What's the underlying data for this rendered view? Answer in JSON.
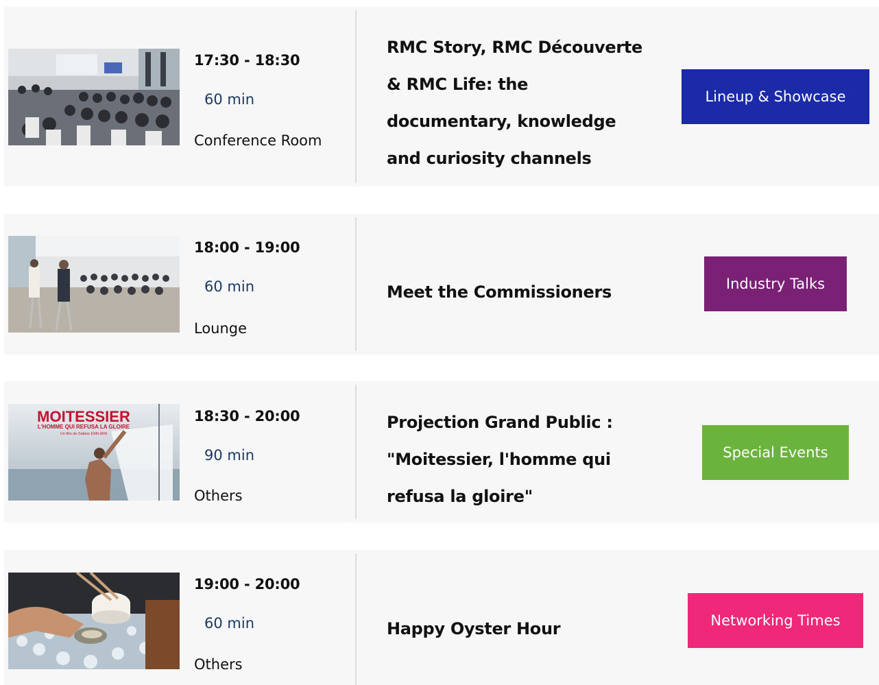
{
  "sessions": [
    {
      "time": "17:30 - 18:30",
      "duration": "60 min",
      "room": "Conference Room",
      "title": "RMC Story, RMC Découverte & RMC Life: the documentary, knowledge and curiosity channels",
      "category": "Lineup & Showcase",
      "category_color": "#1b2aa8",
      "image": "conference-photo"
    },
    {
      "time": "18:00 - 19:00",
      "duration": "60 min",
      "room": "Lounge",
      "title": "Meet the Commissioners",
      "category": "Industry Talks",
      "category_color": "#7a2075",
      "image": "lounge-talk-photo"
    },
    {
      "time": "18:30 - 20:00",
      "duration": "90 min",
      "room": "Others",
      "title": "Projection Grand Public : \"Moitessier, l'homme qui refusa la gloire\"",
      "category": "Special Events",
      "category_color": "#6ab33c",
      "image": "moitessier-poster",
      "poster": {
        "title": "MOITESSIER",
        "subtitle": "L'HOMME QUI REFUSA LA GLOIRE",
        "credit": "Un film de Sabine EMILIANI"
      }
    },
    {
      "time": "19:00 - 20:00",
      "duration": "60 min",
      "room": "Others",
      "title": "Happy Oyster Hour",
      "category": "Networking Times",
      "category_color": "#f0287a",
      "image": "oyster-photo"
    }
  ]
}
